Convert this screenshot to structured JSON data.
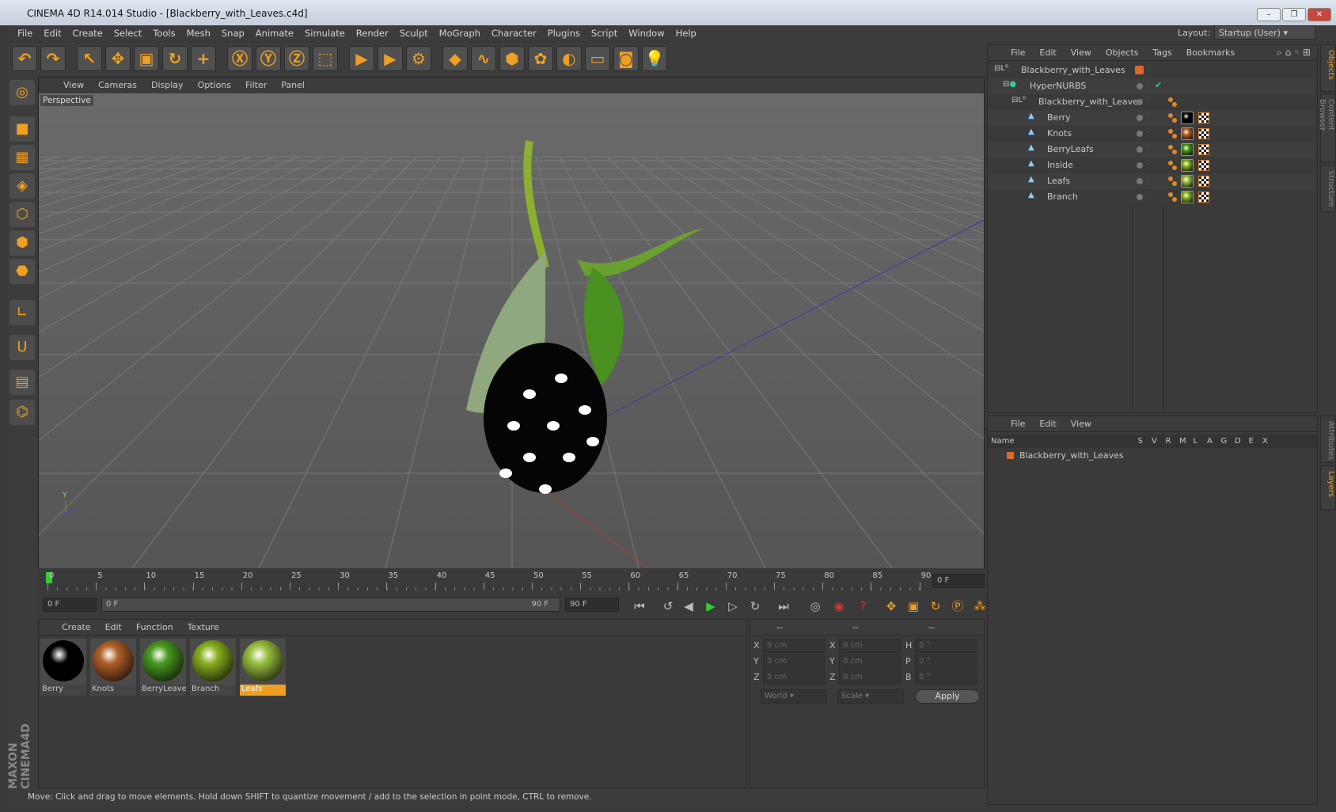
{
  "window": {
    "title": "CINEMA 4D R14.014 Studio - [Blackberry_with_Leaves.c4d]"
  },
  "menu": [
    "File",
    "Edit",
    "Create",
    "Select",
    "Tools",
    "Mesh",
    "Snap",
    "Animate",
    "Simulate",
    "Render",
    "Sculpt",
    "MoGraph",
    "Character",
    "Plugins",
    "Script",
    "Window",
    "Help"
  ],
  "layout": {
    "label": "Layout:",
    "value": "Startup (User)"
  },
  "toolbar": [
    "undo-icon",
    "redo-icon",
    "select-icon",
    "move-icon",
    "scale-icon",
    "rotate-icon",
    "add-icon",
    "x-axis-icon",
    "y-axis-icon",
    "z-axis-icon",
    "world-coord-icon",
    "render-view-icon",
    "render-picture-icon",
    "render-settings-icon",
    "cube-icon",
    "spline-icon",
    "nurbs-icon",
    "array-icon",
    "deformer-icon",
    "floor-icon",
    "camera-icon",
    "light-icon"
  ],
  "viewport": {
    "menu": [
      "View",
      "Cameras",
      "Display",
      "Options",
      "Filter",
      "Panel"
    ],
    "label": "Perspective"
  },
  "timeline": {
    "ticks": [
      "0",
      "5",
      "10",
      "15",
      "20",
      "25",
      "30",
      "35",
      "40",
      "45",
      "50",
      "55",
      "60",
      "65",
      "70",
      "75",
      "80",
      "85",
      "90"
    ],
    "current": "0 F",
    "start": "0 F",
    "slider_start": "0 F",
    "slider_end": "90 F",
    "end": "90 F"
  },
  "materials": {
    "menu": [
      "Create",
      "Edit",
      "Function",
      "Texture"
    ],
    "items": [
      {
        "name": "Berry",
        "color": "#000000"
      },
      {
        "name": "Knots",
        "color": "#b0602a"
      },
      {
        "name": "BerryLeave",
        "color": "#4a9a20"
      },
      {
        "name": "Branch",
        "color": "#8ab020"
      },
      {
        "name": "Leafs",
        "color": "#9ac040",
        "selected": true
      }
    ]
  },
  "coords": {
    "headers": [
      "--",
      "--",
      "--"
    ],
    "rows": [
      {
        "a": "X",
        "av": "0 cm",
        "b": "X",
        "bv": "0 cm",
        "c": "H",
        "cv": "0 °"
      },
      {
        "a": "Y",
        "av": "0 cm",
        "b": "Y",
        "bv": "0 cm",
        "c": "P",
        "cv": "0 °"
      },
      {
        "a": "Z",
        "av": "0 cm",
        "b": "Z",
        "bv": "0 cm",
        "c": "B",
        "cv": "0 °"
      }
    ],
    "world": "World",
    "scale": "Scale",
    "apply": "Apply"
  },
  "status": "Move: Click and drag to move elements. Hold down SHIFT to quantize movement / add to the selection in point mode, CTRL to remove.",
  "objects": {
    "menu": [
      "File",
      "Edit",
      "View",
      "Objects",
      "Tags",
      "Bookmarks"
    ],
    "rows": [
      {
        "name": "Blackberry_with_Leaves",
        "indent": 0,
        "icon": "null-icon"
      },
      {
        "name": "HyperNURBS",
        "indent": 1,
        "icon": "hypernurbs-icon"
      },
      {
        "name": "Blackberry_with_Leaves",
        "indent": 2,
        "icon": "null-icon"
      },
      {
        "name": "Berry",
        "indent": 3,
        "icon": "polygon-icon",
        "mat": "#000000"
      },
      {
        "name": "Knots",
        "indent": 3,
        "icon": "polygon-icon",
        "mat": "#b0602a"
      },
      {
        "name": "BerryLeafs",
        "indent": 3,
        "icon": "polygon-icon",
        "mat": "#4a9a20"
      },
      {
        "name": "Inside",
        "indent": 3,
        "icon": "polygon-icon",
        "mat": "#8ab020"
      },
      {
        "name": "Leafs",
        "indent": 3,
        "icon": "polygon-icon",
        "mat": "#9ac040"
      },
      {
        "name": "Branch",
        "indent": 3,
        "icon": "polygon-icon",
        "mat": "#8ab020"
      }
    ]
  },
  "layers": {
    "menu": [
      "File",
      "Edit",
      "View"
    ],
    "columns": [
      "Name",
      "S",
      "V",
      "R",
      "M",
      "L",
      "A",
      "G",
      "D",
      "E",
      "X"
    ],
    "rows": [
      {
        "name": "Blackberry_with_Leaves"
      }
    ]
  },
  "sidetabs": [
    "Objects",
    "Content Browser",
    "Structure",
    "Attributes",
    "Layers"
  ],
  "brand": "MAXON CINEMA 4D",
  "colors": {
    "accent": "#f0a020",
    "selected": "#f0a020"
  }
}
